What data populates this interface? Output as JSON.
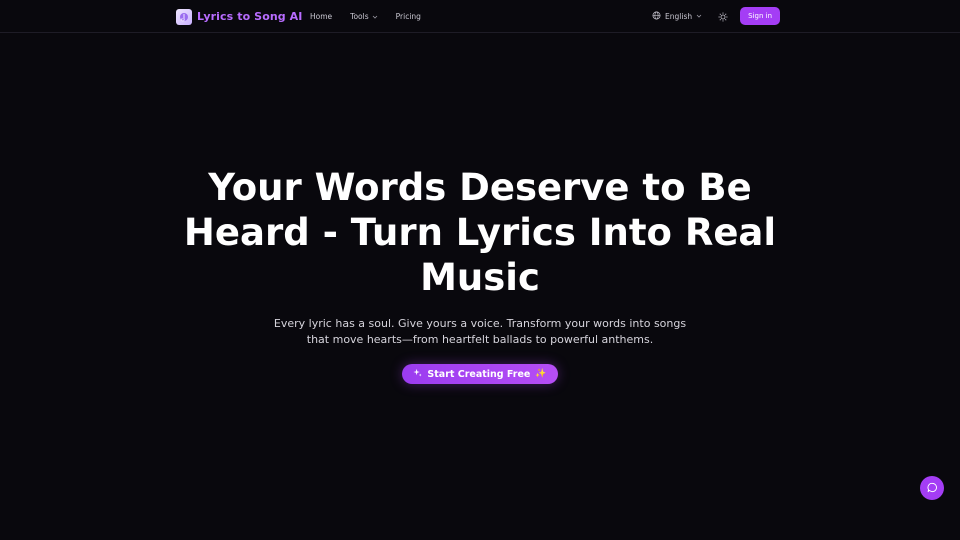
{
  "header": {
    "brand_name": "Lyrics to Song AI",
    "nav": {
      "home": "Home",
      "tools": "Tools",
      "pricing": "Pricing"
    },
    "language": "English",
    "signin_label": "Sign in"
  },
  "hero": {
    "title": "Your Words Deserve to Be Heard - Turn Lyrics Into Real Music",
    "subtitle": "Every lyric has a soul. Give yours a voice. Transform your words into songs that move hearts—from heartfelt ballads to powerful anthems.",
    "cta_label": "Start Creating Free",
    "cta_emoji": "✨"
  },
  "icons": {
    "brand": "app-logo-icon",
    "tools_dropdown": "chevron-down-icon",
    "language": "globe-icon",
    "language_dropdown": "chevron-down-icon",
    "theme": "sun-icon",
    "cta": "sparkles-icon",
    "chat": "chat-bubble-icon"
  },
  "colors": {
    "background": "#09080d",
    "accent": "#a43df5",
    "brand_text": "#b86cff"
  }
}
